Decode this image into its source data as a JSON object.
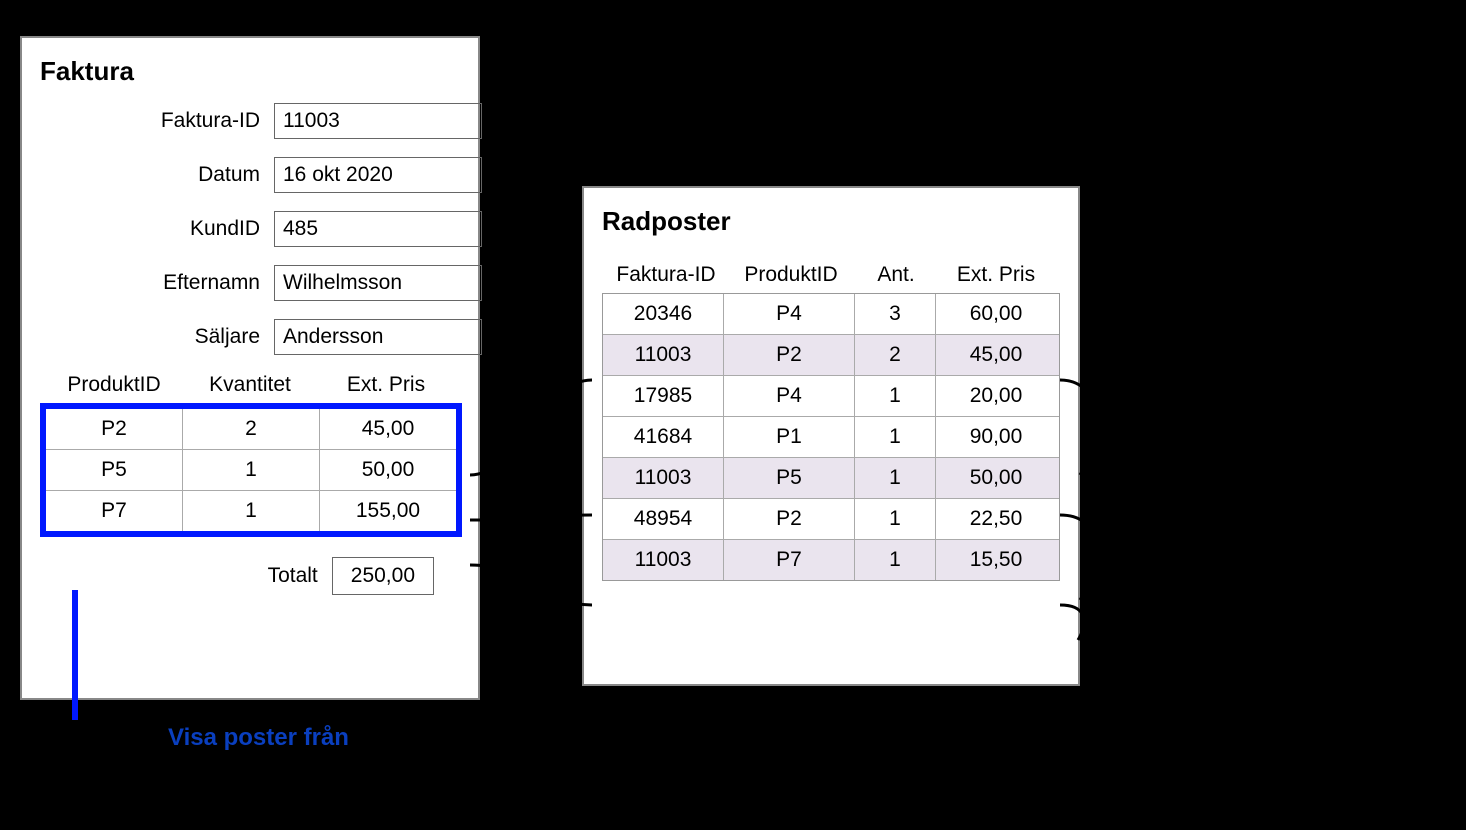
{
  "invoice": {
    "title": "Faktura",
    "fields": {
      "id_label": "Faktura-ID",
      "id_value": "11003",
      "date_label": "Datum",
      "date_value": "16 okt 2020",
      "cust_label": "KundID",
      "cust_value": "485",
      "ln_label": "Efternamn",
      "ln_value": "Wilhelmsson",
      "seller_label": "Säljare",
      "seller_value": "Andersson"
    },
    "table": {
      "head": {
        "prod": "ProduktID",
        "qty": "Kvantitet",
        "ext": "Ext. Pris"
      },
      "rows": [
        {
          "prod": "P2",
          "qty": "2",
          "ext": "45,00"
        },
        {
          "prod": "P5",
          "qty": "1",
          "ext": "50,00"
        },
        {
          "prod": "P7",
          "qty": "1",
          "ext": "155,00"
        }
      ],
      "total_label": "Totalt",
      "total_value": "250,00"
    }
  },
  "lineitems": {
    "title": "Radposter",
    "head": {
      "id": "Faktura-ID",
      "prod": "ProduktID",
      "ant": "Ant.",
      "ext": "Ext. Pris"
    },
    "rows": [
      {
        "id": "20346",
        "prod": "P4",
        "ant": "3",
        "ext": "60,00",
        "hl": false
      },
      {
        "id": "11003",
        "prod": "P2",
        "ant": "2",
        "ext": "45,00",
        "hl": true
      },
      {
        "id": "17985",
        "prod": "P4",
        "ant": "1",
        "ext": "20,00",
        "hl": false
      },
      {
        "id": "41684",
        "prod": "P1",
        "ant": "1",
        "ext": "90,00",
        "hl": false
      },
      {
        "id": "11003",
        "prod": "P5",
        "ant": "1",
        "ext": "50,00",
        "hl": true
      },
      {
        "id": "48954",
        "prod": "P2",
        "ant": "1",
        "ext": "22,50",
        "hl": false
      },
      {
        "id": "11003",
        "prod": "P7",
        "ant": "1",
        "ext": "15,50",
        "hl": true
      }
    ]
  },
  "callout": {
    "text": "Visa poster från"
  }
}
